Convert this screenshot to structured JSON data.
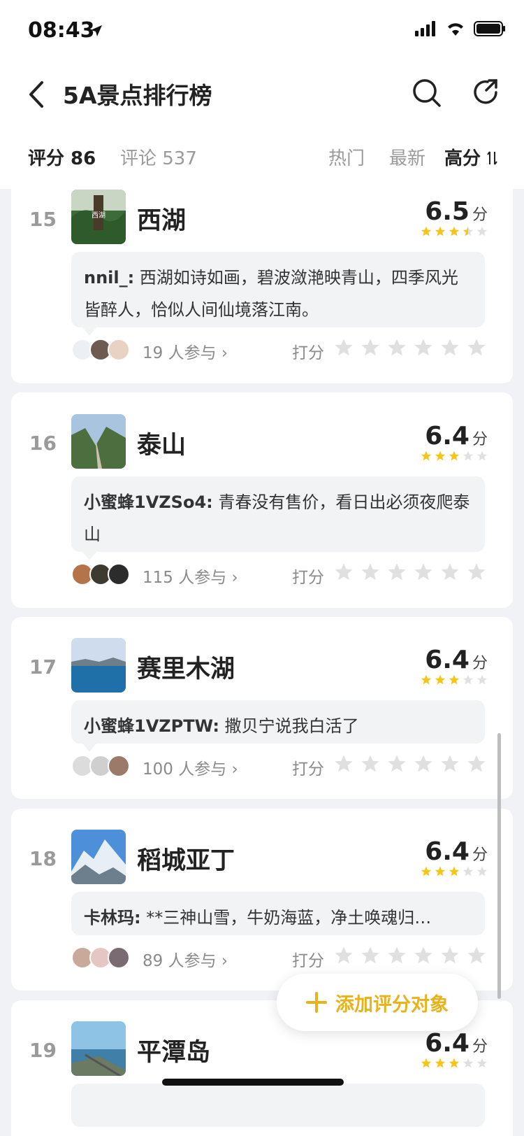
{
  "status": {
    "time": "08:43"
  },
  "nav": {
    "title": "5A景点排行榜"
  },
  "filters": {
    "rating": "评分 86",
    "comments": "评论 537",
    "hot": "热门",
    "newest": "最新",
    "high": "高分",
    "sort_icon": "sort-icon"
  },
  "colors": {
    "accent": "#e8b21a",
    "star_on": "#f5c518",
    "star_off": "#e0e0e0"
  },
  "items": [
    {
      "rank": "15",
      "name": "西湖",
      "score": "6.5",
      "unit": "分",
      "stars": 3.5,
      "comment_user": "nnil_:",
      "comment_text": "西湖如诗如画，碧波潋滟映青山，四季风光皆醉人，恰似人间仙境落江南。",
      "participants": "19 人参与",
      "rate_label": "打分"
    },
    {
      "rank": "16",
      "name": "泰山",
      "score": "6.4",
      "unit": "分",
      "stars": 3,
      "comment_user": "小蜜蜂1VZSo4:",
      "comment_text": "青春没有售价，看日出必须夜爬泰山",
      "participants": "115 人参与",
      "rate_label": "打分"
    },
    {
      "rank": "17",
      "name": "赛里木湖",
      "score": "6.4",
      "unit": "分",
      "stars": 3,
      "comment_user": "小蜜蜂1VZPTW:",
      "comment_text": "撒贝宁说我白活了",
      "participants": "100 人参与",
      "rate_label": "打分"
    },
    {
      "rank": "18",
      "name": "稻城亚丁",
      "score": "6.4",
      "unit": "分",
      "stars": 3,
      "comment_user": "卡林玛:",
      "comment_text": "**三神山雪，牛奶海蓝，净土唤魂归…",
      "participants": "89 人参与",
      "rate_label": "打分"
    },
    {
      "rank": "19",
      "name": "平潭岛",
      "score": "6.4",
      "unit": "分",
      "stars": 3
    }
  ],
  "fab": {
    "label": "添加评分对象"
  }
}
